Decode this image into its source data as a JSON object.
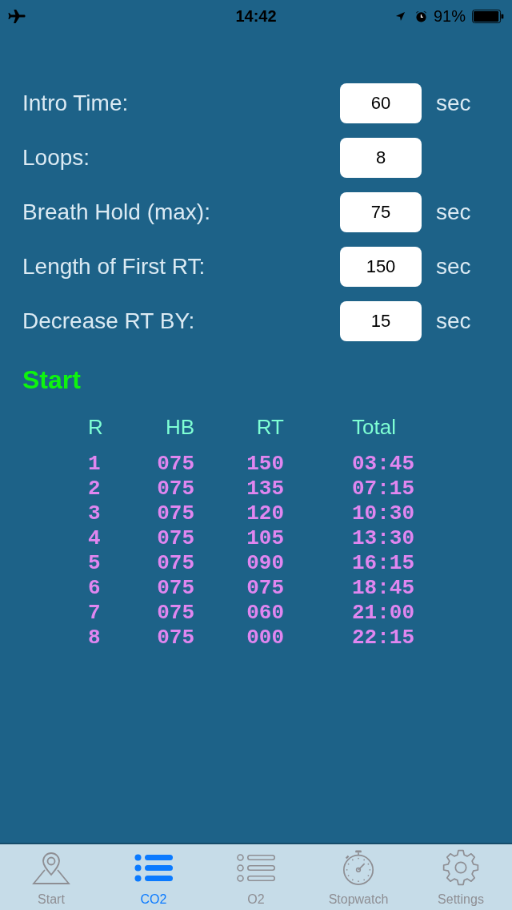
{
  "status_bar": {
    "time": "14:42",
    "battery": "91%"
  },
  "settings": [
    {
      "label": "Intro Time:",
      "value": "60",
      "unit": "sec"
    },
    {
      "label": "Loops:",
      "value": "8"
    },
    {
      "label": "Breath Hold (max):",
      "value": "75",
      "unit": "sec"
    },
    {
      "label": "Length of First RT:",
      "value": "150",
      "unit": "sec"
    },
    {
      "label": "Decrease RT BY:",
      "value": "15",
      "unit": "sec"
    }
  ],
  "start_button": {
    "label": "Start"
  },
  "table": {
    "columns": [
      "R",
      "HB",
      "RT",
      "Total"
    ],
    "rows": [
      [
        "1",
        "075",
        "150",
        "03:45"
      ],
      [
        "2",
        "075",
        "135",
        "07:15"
      ],
      [
        "3",
        "075",
        "120",
        "10:30"
      ],
      [
        "4",
        "075",
        "105",
        "13:30"
      ],
      [
        "5",
        "075",
        "090",
        "16:15"
      ],
      [
        "6",
        "075",
        "075",
        "18:45"
      ],
      [
        "7",
        "075",
        "060",
        "21:00"
      ],
      [
        "8",
        "075",
        "000",
        "22:15"
      ]
    ]
  },
  "tab_bar": {
    "tabs": [
      {
        "label": "Start",
        "selected": false
      },
      {
        "label": "CO2",
        "selected": true
      },
      {
        "label": "O2",
        "selected": false
      },
      {
        "label": "Stopwatch",
        "selected": false
      },
      {
        "label": "Settings",
        "selected": false
      }
    ]
  }
}
